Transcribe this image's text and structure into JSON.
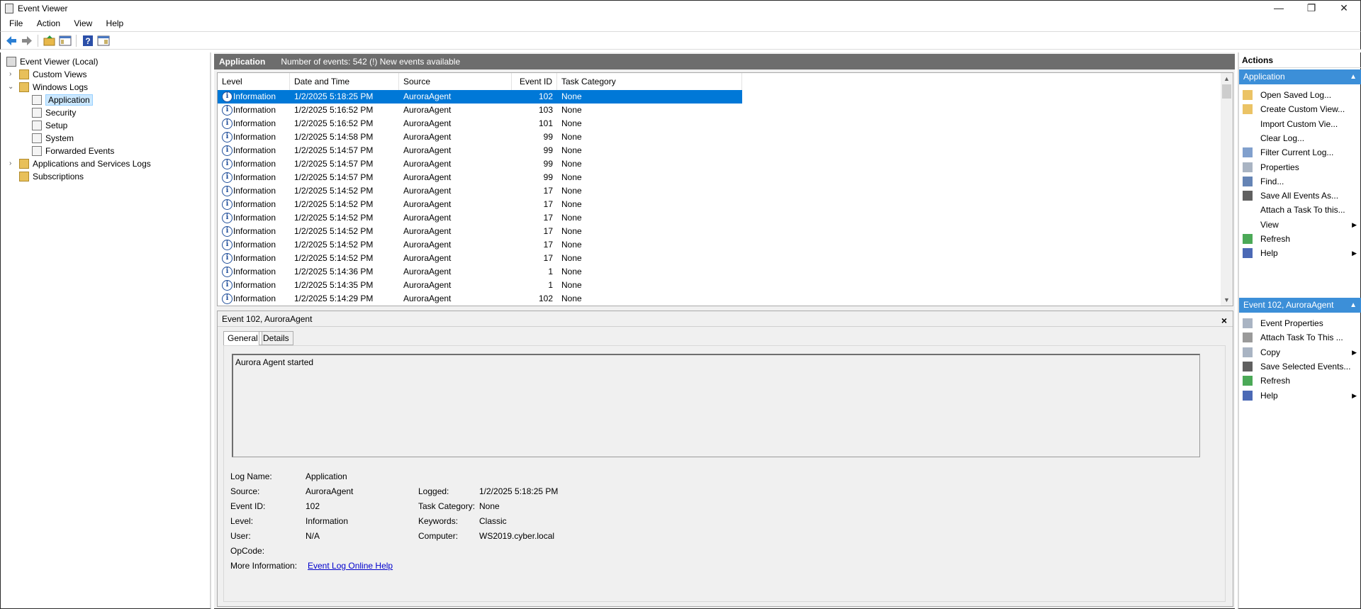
{
  "window": {
    "title": "Event Viewer",
    "minimize": "—",
    "restore": "❐",
    "close": "✕"
  },
  "menu": [
    "File",
    "Action",
    "View",
    "Help"
  ],
  "tree": {
    "root": "Event Viewer (Local)",
    "custom_views": "Custom Views",
    "windows_logs": "Windows Logs",
    "application": "Application",
    "security": "Security",
    "setup": "Setup",
    "system": "System",
    "forwarded": "Forwarded Events",
    "app_services": "Applications and Services Logs",
    "subscriptions": "Subscriptions"
  },
  "log_header": {
    "name": "Application",
    "info": "Number of events: 542 (!) New events available"
  },
  "columns": {
    "level": "Level",
    "datetime": "Date and Time",
    "source": "Source",
    "event_id": "Event ID",
    "task_category": "Task Category"
  },
  "events": [
    {
      "level": "Information",
      "datetime": "1/2/2025 5:18:25 PM",
      "source": "AuroraAgent",
      "event_id": "102",
      "task": "None"
    },
    {
      "level": "Information",
      "datetime": "1/2/2025 5:16:52 PM",
      "source": "AuroraAgent",
      "event_id": "103",
      "task": "None"
    },
    {
      "level": "Information",
      "datetime": "1/2/2025 5:16:52 PM",
      "source": "AuroraAgent",
      "event_id": "101",
      "task": "None"
    },
    {
      "level": "Information",
      "datetime": "1/2/2025 5:14:58 PM",
      "source": "AuroraAgent",
      "event_id": "99",
      "task": "None"
    },
    {
      "level": "Information",
      "datetime": "1/2/2025 5:14:57 PM",
      "source": "AuroraAgent",
      "event_id": "99",
      "task": "None"
    },
    {
      "level": "Information",
      "datetime": "1/2/2025 5:14:57 PM",
      "source": "AuroraAgent",
      "event_id": "99",
      "task": "None"
    },
    {
      "level": "Information",
      "datetime": "1/2/2025 5:14:57 PM",
      "source": "AuroraAgent",
      "event_id": "99",
      "task": "None"
    },
    {
      "level": "Information",
      "datetime": "1/2/2025 5:14:52 PM",
      "source": "AuroraAgent",
      "event_id": "17",
      "task": "None"
    },
    {
      "level": "Information",
      "datetime": "1/2/2025 5:14:52 PM",
      "source": "AuroraAgent",
      "event_id": "17",
      "task": "None"
    },
    {
      "level": "Information",
      "datetime": "1/2/2025 5:14:52 PM",
      "source": "AuroraAgent",
      "event_id": "17",
      "task": "None"
    },
    {
      "level": "Information",
      "datetime": "1/2/2025 5:14:52 PM",
      "source": "AuroraAgent",
      "event_id": "17",
      "task": "None"
    },
    {
      "level": "Information",
      "datetime": "1/2/2025 5:14:52 PM",
      "source": "AuroraAgent",
      "event_id": "17",
      "task": "None"
    },
    {
      "level": "Information",
      "datetime": "1/2/2025 5:14:52 PM",
      "source": "AuroraAgent",
      "event_id": "17",
      "task": "None"
    },
    {
      "level": "Information",
      "datetime": "1/2/2025 5:14:36 PM",
      "source": "AuroraAgent",
      "event_id": "1",
      "task": "None"
    },
    {
      "level": "Information",
      "datetime": "1/2/2025 5:14:35 PM",
      "source": "AuroraAgent",
      "event_id": "1",
      "task": "None"
    },
    {
      "level": "Information",
      "datetime": "1/2/2025 5:14:29 PM",
      "source": "AuroraAgent",
      "event_id": "102",
      "task": "None"
    }
  ],
  "detail": {
    "title": "Event 102, AuroraAgent",
    "close": "×",
    "tabs": {
      "general": "General",
      "details": "Details"
    },
    "description": "Aurora Agent started",
    "labels": {
      "log_name": "Log Name:",
      "source": "Source:",
      "event_id": "Event ID:",
      "level": "Level:",
      "user": "User:",
      "opcode": "OpCode:",
      "more_info": "More Information:",
      "logged": "Logged:",
      "task_category": "Task Category:",
      "keywords": "Keywords:",
      "computer": "Computer:"
    },
    "values": {
      "log_name": "Application",
      "source": "AuroraAgent",
      "event_id": "102",
      "level": "Information",
      "user": "N/A",
      "opcode": "",
      "more_info_link": "Event Log Online Help",
      "logged": "1/2/2025 5:18:25 PM",
      "task_category": "None",
      "keywords": "Classic",
      "computer": "WS2019.cyber.local"
    }
  },
  "actions": {
    "title": "Actions",
    "group1": "Application",
    "group1_items": [
      "Open Saved Log...",
      "Create Custom View...",
      "Import Custom Vie...",
      "Clear Log...",
      "Filter Current Log...",
      "Properties",
      "Find...",
      "Save All Events As...",
      "Attach a Task To this...",
      "View",
      "Refresh",
      "Help"
    ],
    "group2": "Event 102, AuroraAgent",
    "group2_items": [
      "Event Properties",
      "Attach Task To This ...",
      "Copy",
      "Save Selected Events...",
      "Refresh",
      "Help"
    ]
  },
  "colors": {
    "selection": "#0078d7",
    "header_bar": "#6d6d6d",
    "action_group": "#3c8fd8",
    "link": "#0000cc"
  }
}
